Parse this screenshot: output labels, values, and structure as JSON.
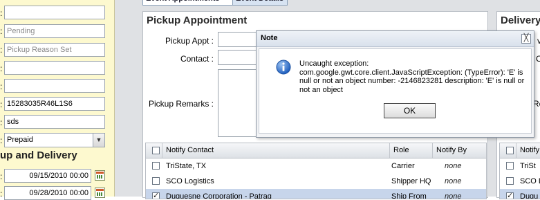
{
  "left": {
    "fields": [
      "",
      "Pending",
      "Pickup Reason Set",
      "",
      "",
      "15283035R46L1S6",
      "sds"
    ],
    "select_value": "Prepaid",
    "section_heading": "up and Delivery",
    "dates": [
      "09/15/2010 00:00",
      "09/28/2010 00:00"
    ]
  },
  "tabs": [
    "Event Appointments",
    "Event Details"
  ],
  "pickup": {
    "title": "Pickup Appointment",
    "appt_label": "Pickup Appt :",
    "contact_label": "Contact :",
    "remarks_label": "Pickup Remarks :"
  },
  "grid": {
    "columns": [
      "Notify Contact",
      "Role",
      "Notify By"
    ],
    "rows": [
      {
        "contact": "TriState, TX",
        "role": "Carrier",
        "notify": "none",
        "checked": false,
        "selected": false
      },
      {
        "contact": "SCO Logistics",
        "role": "Shipper HQ",
        "notify": "none",
        "checked": false,
        "selected": false
      },
      {
        "contact": "Duquesne Corporation - Patraq",
        "role": "Ship From",
        "notify": "none",
        "checked": true,
        "selected": true
      }
    ]
  },
  "delivery": {
    "title": "Delivery",
    "labels": [
      "ver",
      "C",
      "Re"
    ],
    "grid_column": "Notify",
    "rows": [
      "TriSt",
      "SCO L",
      "Duqu"
    ]
  },
  "dialog": {
    "title": "Note",
    "close_glyph": "╳",
    "message": "Uncaught exception: com.google.gwt.core.client.JavaScriptException: (TypeError): 'E' is null or not an object number: -2146823281 description: 'E' is null or not an object",
    "ok_label": "OK"
  },
  "colors": {
    "left_panel_bg": "#fdf9cf",
    "selected_row": "#c7d5eb",
    "info_icon": "#2a6acb"
  }
}
